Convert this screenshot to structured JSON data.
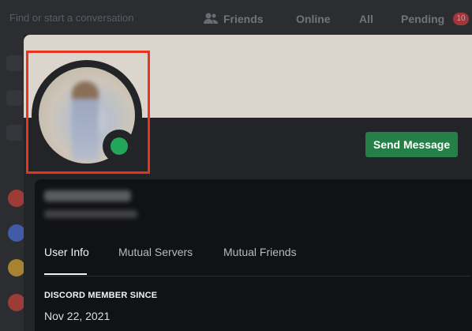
{
  "background": {
    "search_placeholder": "Find or start a conversation",
    "friends_label": "Friends",
    "tabs": [
      "Online",
      "All",
      "Pending"
    ],
    "pending_count": "10"
  },
  "profile": {
    "send_message_label": "Send Message",
    "tabs": [
      {
        "label": "User Info",
        "active": true
      },
      {
        "label": "Mutual Servers",
        "active": false
      },
      {
        "label": "Mutual Friends",
        "active": false
      }
    ],
    "member_since_heading": "DISCORD MEMBER SINCE",
    "member_since_date": "Nov 22, 2021",
    "status": "online",
    "colors": {
      "banner": "#dcd5cd",
      "status_online": "#23a55a",
      "send_button": "#248046",
      "highlight_box": "#e8331f"
    }
  }
}
